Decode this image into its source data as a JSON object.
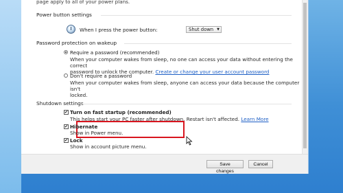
{
  "intro": {
    "text": "page apply to all of your power plans."
  },
  "power_button": {
    "heading": "Power button settings",
    "when_label": "When I press the power button:",
    "dropdown_value": "Shut down"
  },
  "wakeup": {
    "heading": "Password protection on wakeup",
    "require_label": "Require a password (recommended)",
    "require_desc_1": "When your computer wakes from sleep, no one can access your data without entering the correct",
    "require_desc_2": "password to unlock the computer.",
    "require_link": "Create or change your user account password",
    "dont_label": "Don't require a password",
    "dont_desc_1": "When your computer wakes from sleep, anyone can access your data because the computer isn't",
    "dont_desc_2": "locked."
  },
  "shutdown": {
    "heading": "Shutdown settings",
    "fast_startup_label": "Turn on fast startup (recommended)",
    "fast_startup_desc": "This helps start your PC faster after shutdown. Restart isn't affected.",
    "learn_more": "Learn More",
    "hibernate_label": "Hibernate",
    "hibernate_desc": "Show in Power menu.",
    "lock_label": "Lock",
    "lock_desc": "Show in account picture menu."
  },
  "footer": {
    "save_label": "Save changes",
    "cancel_label": "Cancel"
  },
  "checkmark": "✔",
  "colors": {
    "highlight": "#d8141e",
    "link": "#1c5ec5",
    "desktop": "#3f8fd6"
  }
}
